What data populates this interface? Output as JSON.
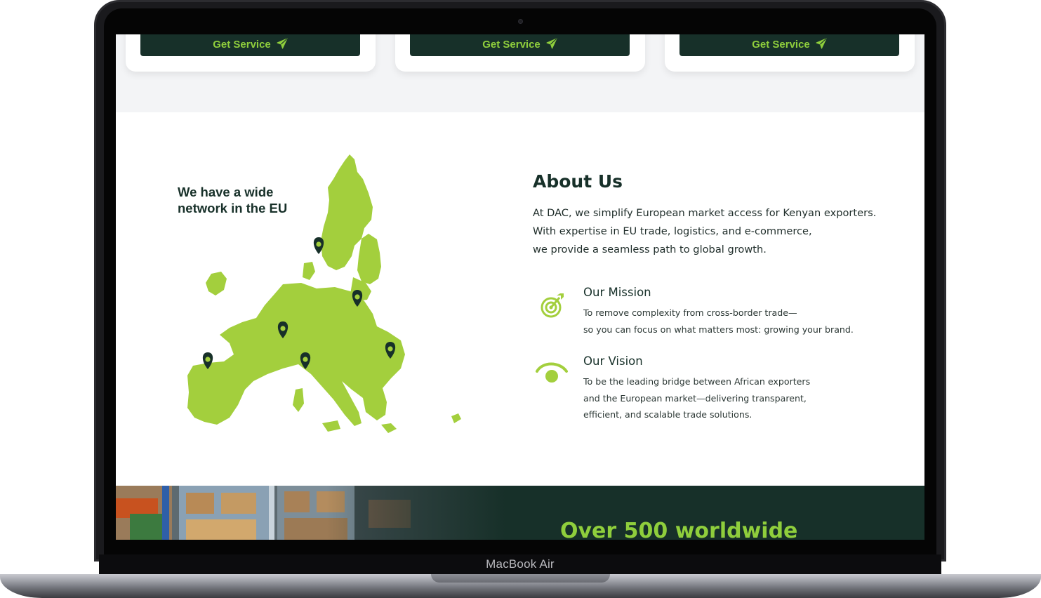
{
  "device": {
    "label": "MacBook Air"
  },
  "services": {
    "cards": [
      {
        "button_label": "Get Service",
        "icon": "paper-plane-icon"
      },
      {
        "button_label": "Get Service",
        "icon": "paper-plane-icon"
      },
      {
        "button_label": "Get Service",
        "icon": "paper-plane-icon"
      }
    ]
  },
  "map": {
    "caption_line1": "We have a wide",
    "caption_line2": "network in the EU",
    "pin_icon": "map-pin-icon"
  },
  "about": {
    "title": "About Us",
    "lines": [
      "At DAC, we simplify European market access for Kenyan exporters.",
      "With expertise in EU trade, logistics, and e-commerce,",
      "we provide a seamless path to global growth."
    ],
    "mission": {
      "icon": "target-icon",
      "heading": "Our Mission",
      "lines": [
        "To remove complexity from cross-border trade—",
        "so you can focus on what matters most: growing your brand."
      ]
    },
    "vision": {
      "icon": "eye-icon",
      "heading": "Our Vision",
      "lines": [
        "To be the leading bridge between African exporters",
        "and the European market—delivering transparent,",
        "efficient, and scalable trade solutions."
      ]
    }
  },
  "stats": {
    "headline": "Over 500 worldwide"
  },
  "colors": {
    "brand_dark": "#173029",
    "accent_green": "#8fce3c",
    "map_green": "#a3cf3d"
  }
}
